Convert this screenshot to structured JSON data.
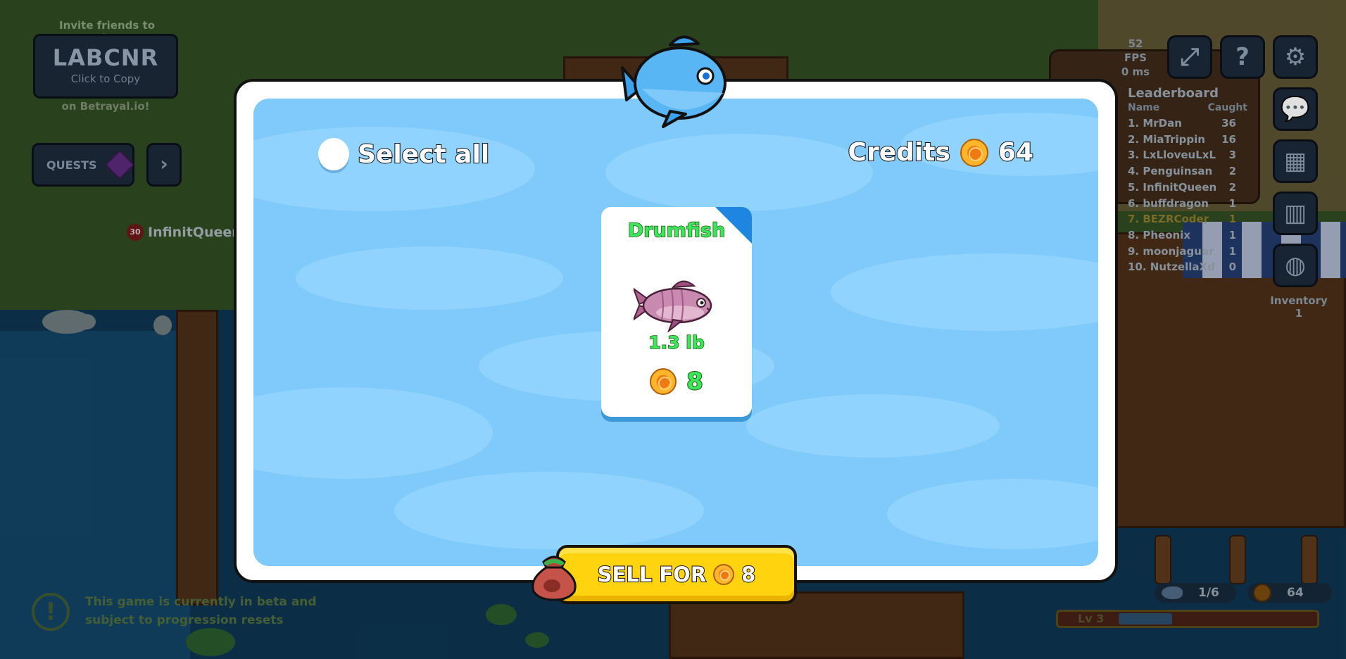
{
  "hud_left": {
    "invite_label": "Invite friends to play",
    "party_code": "LABCNR",
    "click_to_copy": "Click to Copy",
    "on_site": "on Betrayal.io!",
    "quests_label": "QUESTS",
    "player_level": "30",
    "player_name": "InfinitQueen",
    "beta_notice": "This game is currently in beta and subject to progression resets"
  },
  "hud_right": {
    "fps": "52 FPS",
    "ping": "0 ms",
    "leaderboard": {
      "title": "Leaderboard",
      "col_name": "Name",
      "col_caught": "Caught",
      "rows": [
        {
          "name": "1. MrDan",
          "caught": "36"
        },
        {
          "name": "2. MiaTrippin",
          "caught": "16"
        },
        {
          "name": "3. LxLloveuLxL",
          "caught": "3"
        },
        {
          "name": "4. Penguinsan",
          "caught": "2"
        },
        {
          "name": "5. InfinitQueen",
          "caught": "2"
        },
        {
          "name": "6. buffdragon",
          "caught": "1"
        },
        {
          "name": "7. BEZRCoder",
          "caught": "1"
        },
        {
          "name": "8. Pheonix",
          "caught": "1"
        },
        {
          "name": "9. moonjaguar",
          "caught": "1"
        },
        {
          "name": "10. NutzellaXd",
          "caught": "0"
        }
      ]
    },
    "inventory_label": "Inventory",
    "inventory_count": "1",
    "fish_count": "1/6",
    "credits": "64",
    "level": "Lv 3",
    "level_progress": 0.27
  },
  "modal": {
    "select_all_label": "Select all",
    "credits_label": "Credits",
    "credits_value": "64",
    "fish": {
      "name": "Drumfish",
      "weight": "1.3 lb",
      "price": "8"
    },
    "sell_label": "SELL FOR",
    "sell_value": "8"
  },
  "colors": {
    "modal_water": "#80cafb",
    "fish_text": "#3ce55a",
    "sell_button": "#ffd40f",
    "card_corner": "#1e86e0"
  }
}
